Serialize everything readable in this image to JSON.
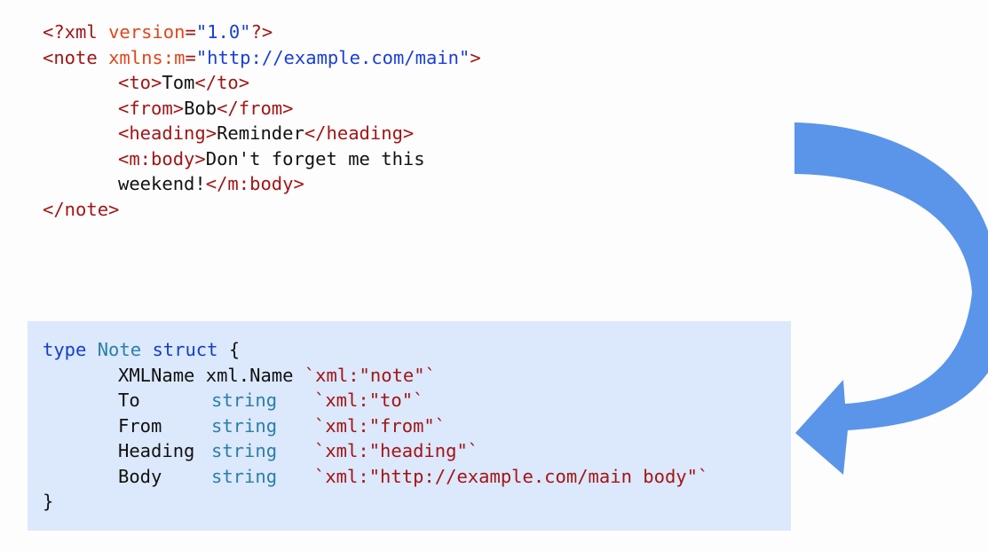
{
  "xml": {
    "decl_open": "<?xml",
    "decl_attr": "version",
    "decl_eq": "=",
    "decl_val": "\"1.0\"",
    "decl_close": "?>",
    "note_open": "<note",
    "note_attr": "xmlns:m",
    "note_eq": "=",
    "note_val": "\"http://example.com/main\"",
    "note_close": ">",
    "to_open": "<to>",
    "to_text": "Tom",
    "to_close": "</to>",
    "from_open": "<from>",
    "from_text": "Bob",
    "from_close": "</from>",
    "heading_open": "<heading>",
    "heading_text": "Reminder",
    "heading_close": "</heading>",
    "body_open": "<m:body>",
    "body_text_1": "Don't forget me this",
    "body_text_2": "weekend!",
    "body_close": "</m:body>",
    "note_end": "</note>"
  },
  "go": {
    "kw_type": "type",
    "struct_name": "Note",
    "kw_struct": "struct",
    "open_brace": "{",
    "close_brace": "}",
    "fields": [
      {
        "name": "XMLName",
        "type": "xml.Name",
        "tag": "`xml:\"note\"`"
      },
      {
        "name": "To",
        "type": "string",
        "tag": "`xml:\"to\"`"
      },
      {
        "name": "From",
        "type": "string",
        "tag": "`xml:\"from\"`"
      },
      {
        "name": "Heading",
        "type": "string",
        "tag": "`xml:\"heading\"`"
      },
      {
        "name": "Body",
        "type": "string",
        "tag": "`xml:\"http://example.com/main body\"`"
      }
    ]
  },
  "colors": {
    "panel_bg": "#dce8fb",
    "arrow": "#5b95ea",
    "tag": "#a31515",
    "attribute": "#e0461b",
    "string": "#1a3fd8",
    "keyword": "#1340c8",
    "type": "#2b7fa8"
  }
}
